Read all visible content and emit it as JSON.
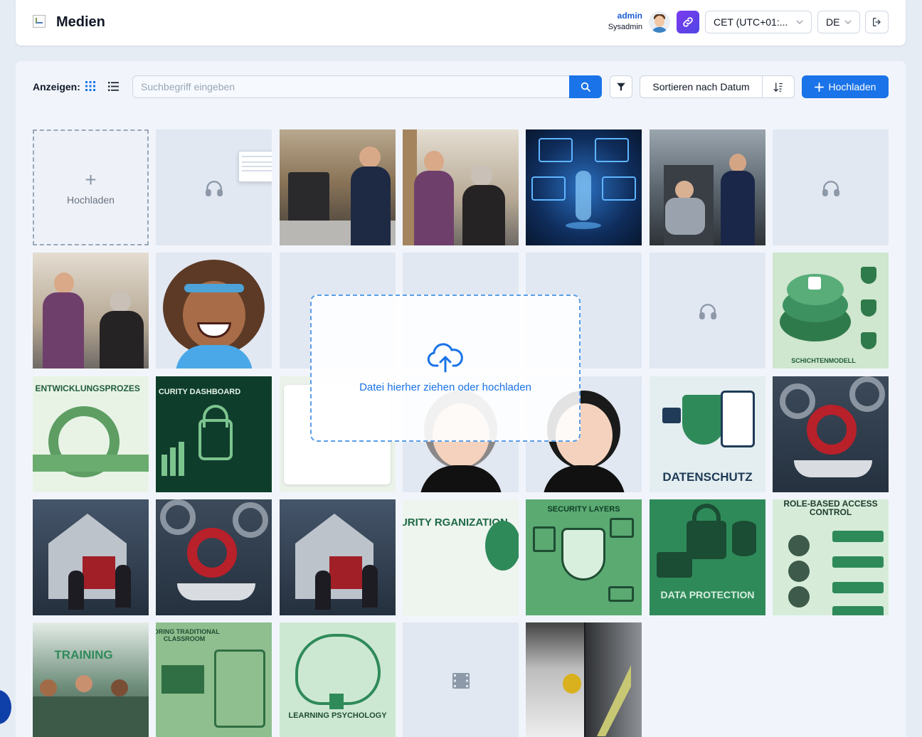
{
  "header": {
    "title": "Medien",
    "user": {
      "name": "admin",
      "role": "Sysadmin"
    },
    "timezone": "CET (UTC+01:...",
    "language": "DE"
  },
  "toolbar": {
    "show_label": "Anzeigen:",
    "search_placeholder": "Suchbegriff eingeben",
    "sort_label": "Sortieren nach Datum",
    "upload_label": "Hochladen"
  },
  "upload_tile": {
    "label": "Hochladen"
  },
  "drop_zone": {
    "message": "Datei hierher ziehen oder hochladen"
  },
  "media": [
    {
      "kind": "audio"
    },
    {
      "kind": "photo",
      "subject": "coffee-machine"
    },
    {
      "kind": "photo",
      "subject": "pharmacy-consultation"
    },
    {
      "kind": "illustration",
      "subject": "cyber-figure"
    },
    {
      "kind": "photo",
      "subject": "train-conductor"
    },
    {
      "kind": "audio"
    },
    {
      "kind": "photo",
      "subject": "pharmacy-consultation"
    },
    {
      "kind": "avatar",
      "subject": "woman-avatar"
    },
    {
      "kind": "audio"
    },
    {
      "kind": "audio"
    },
    {
      "kind": "audio"
    },
    {
      "kind": "audio"
    },
    {
      "kind": "illustration",
      "subject": "layers",
      "caption": "SCHICHTENMODELL"
    },
    {
      "kind": "illustration",
      "subject": "agile",
      "caption": "GILE ENTWICKLUNGSPROZES"
    },
    {
      "kind": "illustration",
      "subject": "security-dashboard",
      "caption": "CURITY DASHBOARD"
    },
    {
      "kind": "illustration",
      "subject": "app-ui"
    },
    {
      "kind": "avatar",
      "subject": "woman-avatar"
    },
    {
      "kind": "avatar",
      "subject": "woman-avatar"
    },
    {
      "kind": "illustration",
      "subject": "privacy",
      "caption": "DATENSCHUTZ"
    },
    {
      "kind": "illustration",
      "subject": "gears"
    },
    {
      "kind": "illustration",
      "subject": "puzzle-house"
    },
    {
      "kind": "illustration",
      "subject": "gears"
    },
    {
      "kind": "illustration",
      "subject": "puzzle-house"
    },
    {
      "kind": "illustration",
      "subject": "iso",
      "caption": "CURITY RGANIZATION"
    },
    {
      "kind": "illustration",
      "subject": "security-layers",
      "caption": "SECURITY LAYERS"
    },
    {
      "kind": "illustration",
      "subject": "data-protection",
      "caption": "DATA PROTECTION"
    },
    {
      "kind": "illustration",
      "subject": "rbac",
      "caption": "ROLE-BASED ACCESS CONTROL"
    },
    {
      "kind": "photo",
      "subject": "training",
      "caption": "TRAINING"
    },
    {
      "kind": "illustration",
      "subject": "classroom",
      "caption": "BORING TRADITIONAL CLASSROOM"
    },
    {
      "kind": "illustration",
      "subject": "brain",
      "caption": "LEARNING PSYCHOLOGY"
    },
    {
      "kind": "video"
    },
    {
      "kind": "photo",
      "subject": "cutting-board"
    }
  ],
  "colors": {
    "accent": "#1a73e8",
    "background": "#e6ecf4",
    "panel": "#f1f5fb",
    "placeholder_tile": "#e2e8f2"
  }
}
